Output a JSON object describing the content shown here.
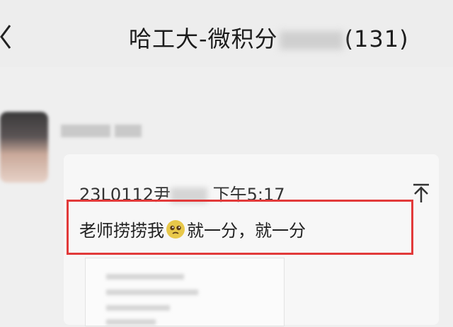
{
  "header": {
    "title_prefix": "哈工大-微积分",
    "title_suffix": "(131)",
    "subline": "",
    "back_icon": "chevron-left-icon"
  },
  "quoted_message": {
    "sender_prefix": "23L0112尹",
    "time": "下午5:17",
    "collapse_icon": "arrow-up-to-line-icon"
  },
  "message": {
    "text_before": "老师捞捞我",
    "emoji": "pleading-face-emoji",
    "text_after": "就一分，就一分"
  },
  "colors": {
    "highlight": "#e23a3a",
    "background": "#efefef",
    "card": "#f7f7f7"
  }
}
